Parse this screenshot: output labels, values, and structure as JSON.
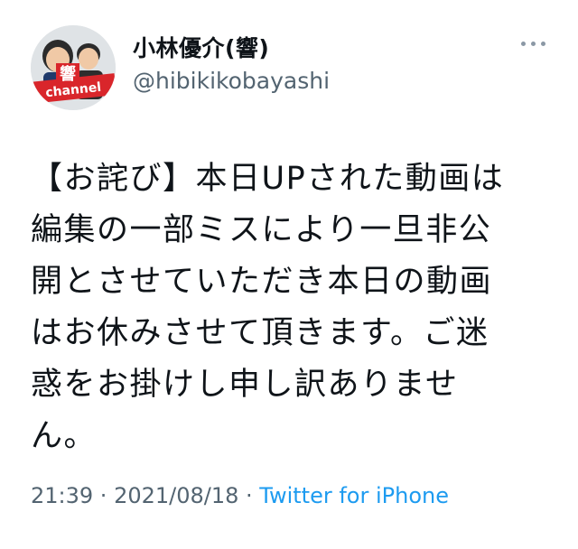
{
  "user": {
    "display_name": "小林優介(響)",
    "handle": "@hibikikobayashi",
    "avatar": {
      "icon": "channel-logo-avatar",
      "logo_text": "響 channel",
      "colors": {
        "brand_red": "#d9262b",
        "skin": "#f0c9a6",
        "hair": "#2b2b2b"
      }
    }
  },
  "tweet": {
    "text": "【お詫び】本日UPされた動画は\n編集の一部ミスにより一旦非公\n開とさせていただき本日の動画\nはお休みさせて頂きます。ご迷\n惑をお掛けし申し訳ありませ\nん。",
    "time": "21:39",
    "separator1": " · ",
    "date": "2021/08/18",
    "separator2": " · ",
    "source": "Twitter for iPhone"
  },
  "icons": {
    "more": "more-dots-icon"
  },
  "colors": {
    "text": "#0f1419",
    "secondary": "#536471",
    "link": "#1d9bf0",
    "background": "#ffffff"
  }
}
